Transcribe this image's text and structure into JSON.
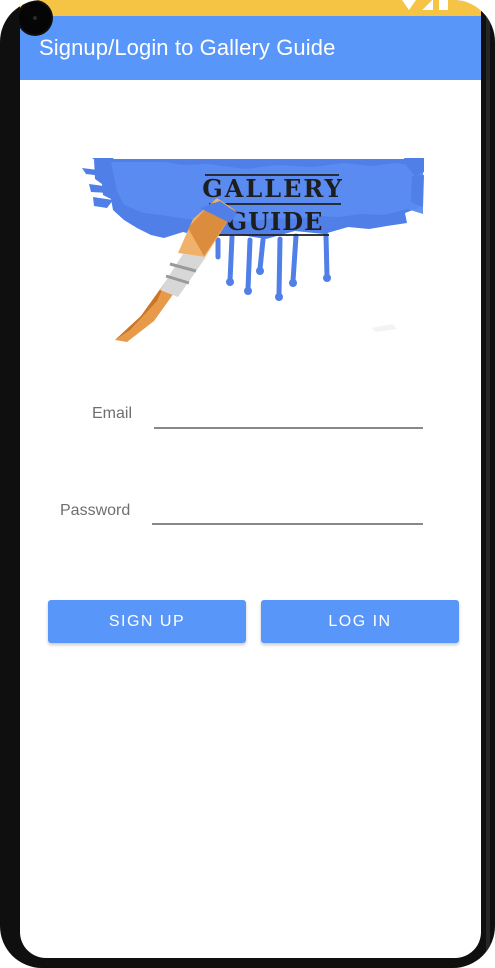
{
  "status_bar": {
    "icons": [
      "wifi-icon",
      "signal-icon",
      "battery-icon"
    ],
    "background_color": "#f6c445"
  },
  "app_bar": {
    "title": "Signup/Login to Gallery Guide",
    "background_color": "#5897f9"
  },
  "logo": {
    "lettering": [
      "GALLERY",
      "GUIDE"
    ],
    "icon": "paintbrush-icon"
  },
  "form": {
    "email": {
      "label": "Email",
      "value": "",
      "placeholder": ""
    },
    "password": {
      "label": "Password",
      "value": "",
      "placeholder": ""
    }
  },
  "buttons": {
    "signup_label": "SIGN UP",
    "login_label": "LOG IN",
    "background_color": "#5897f9"
  }
}
